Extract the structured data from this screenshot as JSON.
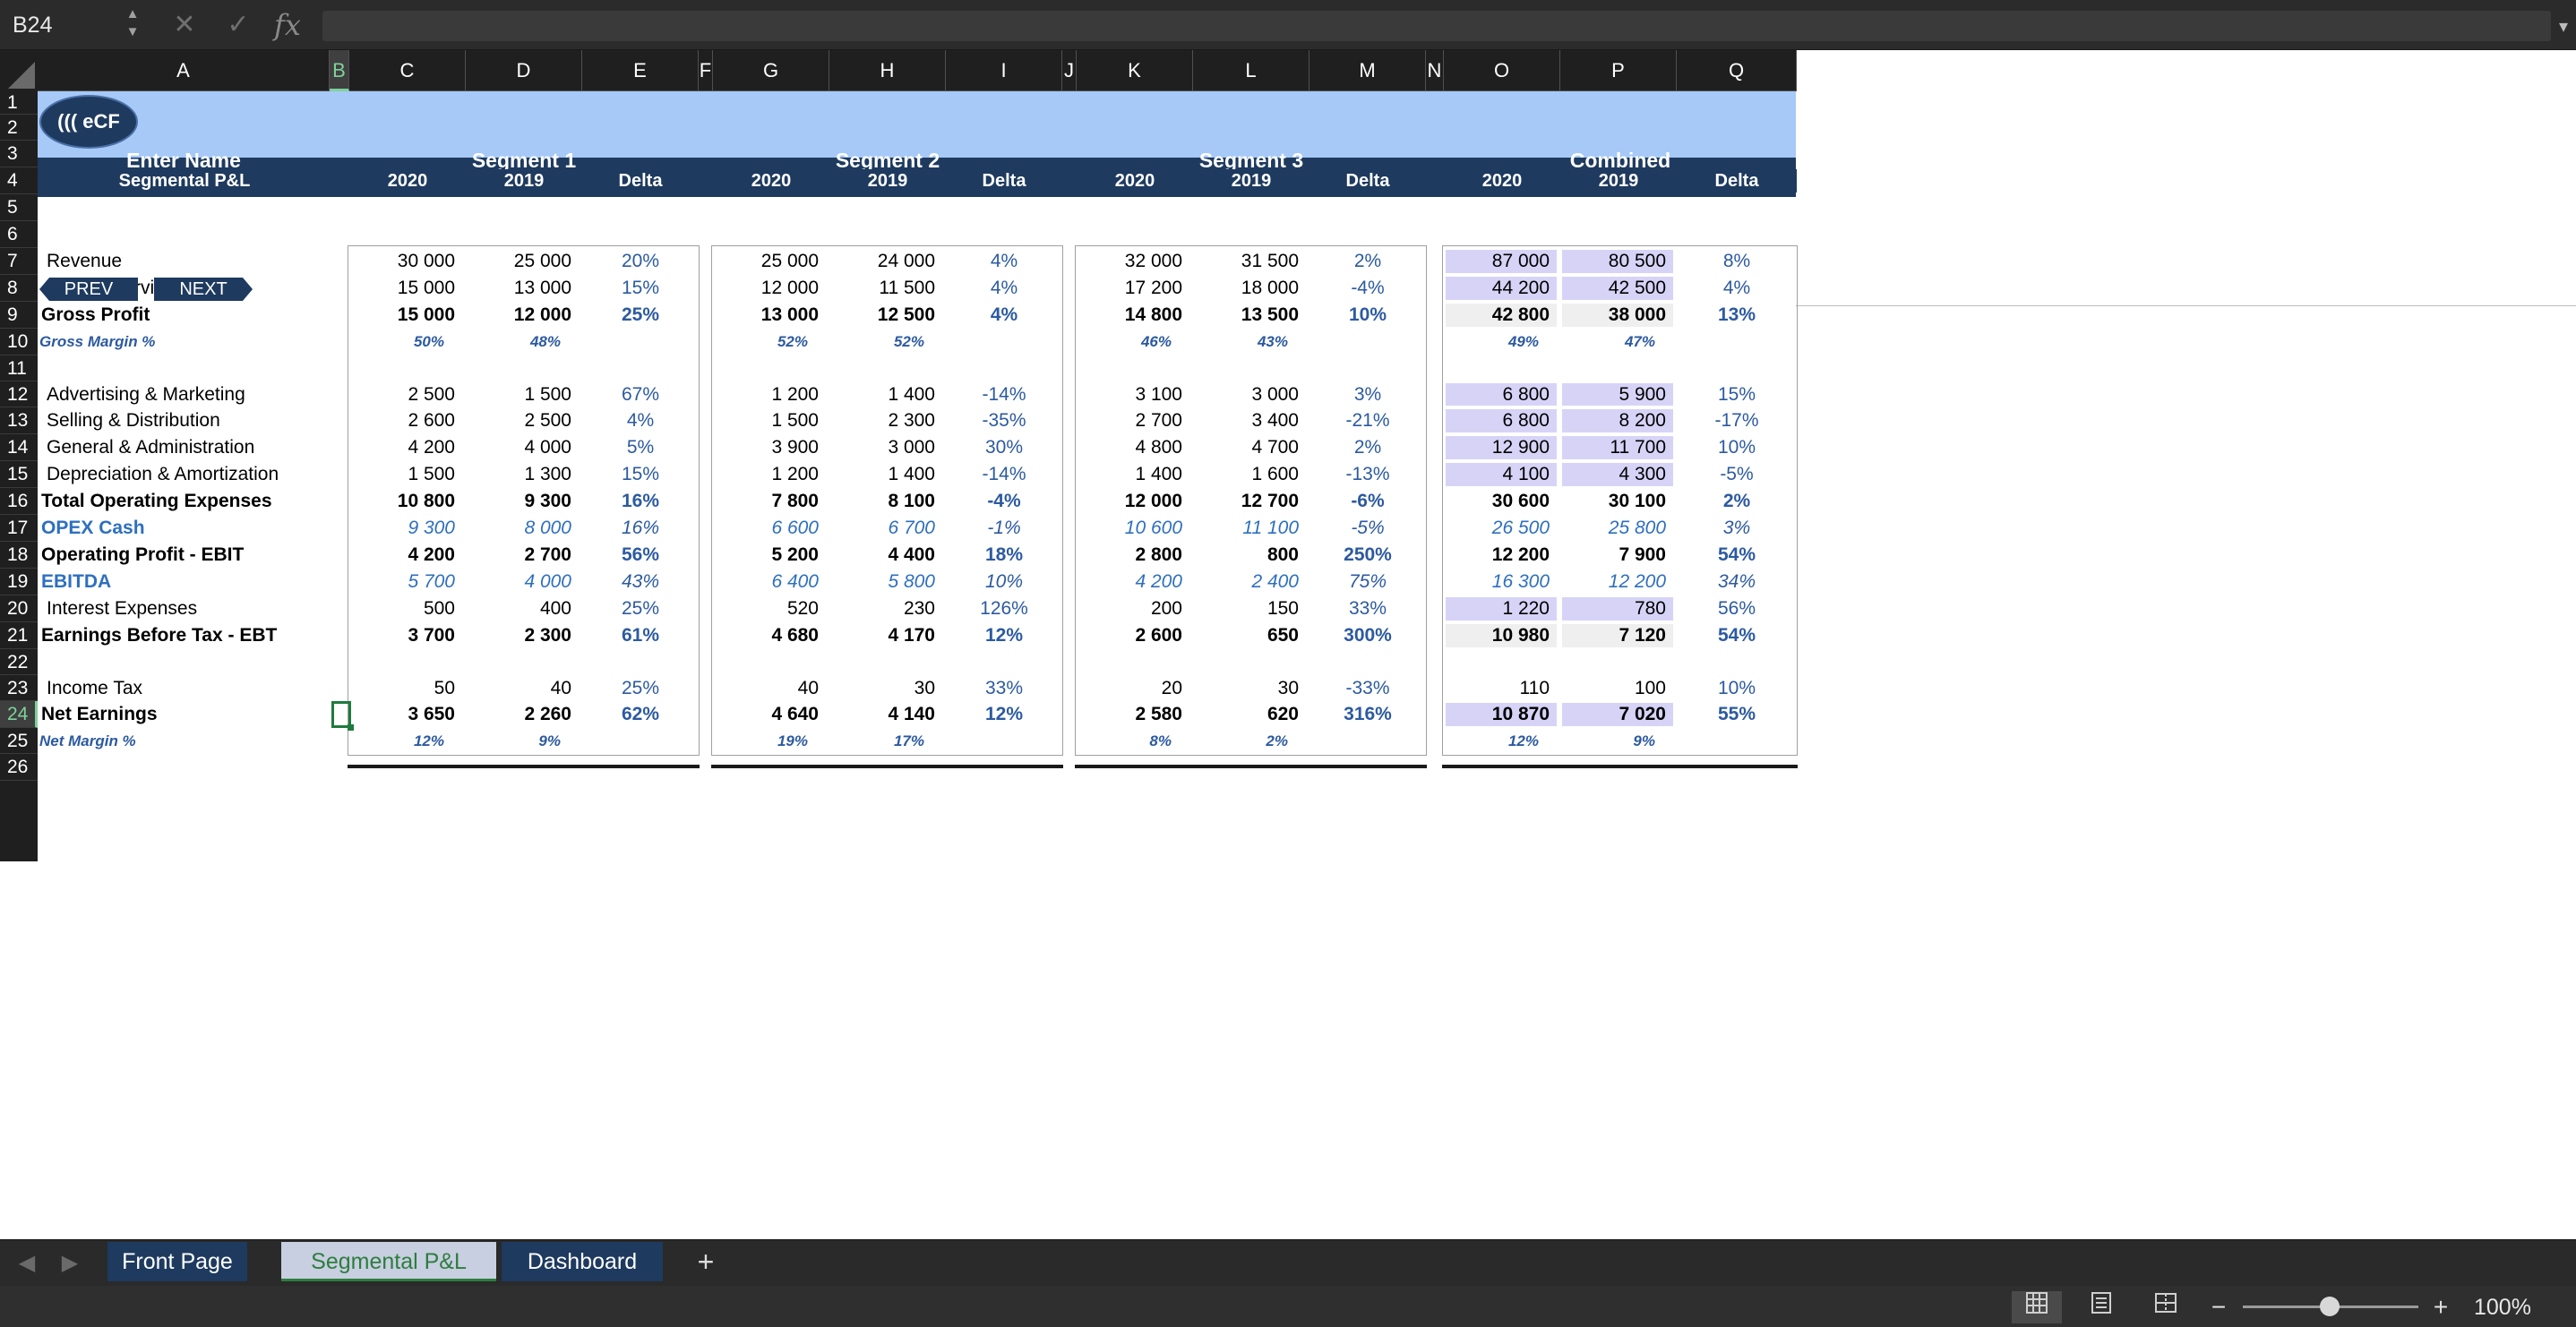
{
  "formula_bar": {
    "name_box": "B24",
    "cancel_glyph": "✕",
    "confirm_glyph": "✓",
    "fx_label": "fx",
    "formula_value": ""
  },
  "columns": [
    "A",
    "B",
    "C",
    "D",
    "E",
    "F",
    "G",
    "H",
    "I",
    "J",
    "K",
    "L",
    "M",
    "N",
    "O",
    "P",
    "Q"
  ],
  "rows": [
    "1",
    "2",
    "3",
    "4",
    "5",
    "6",
    "7",
    "8",
    "9",
    "10",
    "11",
    "12",
    "13",
    "14",
    "15",
    "16",
    "17",
    "18",
    "19",
    "20",
    "21",
    "22",
    "23",
    "24",
    "25",
    "26"
  ],
  "logo_text": "((( eCF",
  "header": {
    "name_label": "Enter Name",
    "sub_label": "Segmental P&L",
    "segments": [
      "Segment 1",
      "Segment 2",
      "Segment 3",
      "Combined"
    ],
    "year_labels": [
      "2020",
      "2019",
      "Delta"
    ]
  },
  "nav": {
    "prev": "PREV",
    "next": "NEXT"
  },
  "lines": [
    {
      "label": "Revenue",
      "style": "normal",
      "s1": [
        "30 000",
        "25 000",
        "20%"
      ],
      "s2": [
        "25 000",
        "24 000",
        "4%"
      ],
      "s3": [
        "32 000",
        "31 500",
        "2%"
      ],
      "c": [
        "87 000",
        "80 500",
        "8%"
      ]
    },
    {
      "label": "Cost of Services",
      "style": "normal",
      "s1": [
        "15 000",
        "13 000",
        "15%"
      ],
      "s2": [
        "12 000",
        "11 500",
        "4%"
      ],
      "s3": [
        "17 200",
        "18 000",
        "-4%"
      ],
      "c": [
        "44 200",
        "42 500",
        "4%"
      ]
    },
    {
      "label": "Gross Profit",
      "style": "bold",
      "s1": [
        "15 000",
        "12 000",
        "25%"
      ],
      "s2": [
        "13 000",
        "12 500",
        "4%"
      ],
      "s3": [
        "14 800",
        "13 500",
        "10%"
      ],
      "c": [
        "42 800",
        "38 000",
        "13%"
      ]
    },
    {
      "label": "Gross Margin %",
      "style": "margin",
      "s1": [
        "50%",
        "48%",
        ""
      ],
      "s2": [
        "52%",
        "52%",
        ""
      ],
      "s3": [
        "46%",
        "43%",
        ""
      ],
      "c": [
        "49%",
        "47%",
        ""
      ]
    },
    {
      "label": "Advertising & Marketing",
      "style": "normal",
      "s1": [
        "2 500",
        "1 500",
        "67%"
      ],
      "s2": [
        "1 200",
        "1 400",
        "-14%"
      ],
      "s3": [
        "3 100",
        "3 000",
        "3%"
      ],
      "c": [
        "6 800",
        "5 900",
        "15%"
      ]
    },
    {
      "label": "Selling & Distribution",
      "style": "normal",
      "s1": [
        "2 600",
        "2 500",
        "4%"
      ],
      "s2": [
        "1 500",
        "2 300",
        "-35%"
      ],
      "s3": [
        "2 700",
        "3 400",
        "-21%"
      ],
      "c": [
        "6 800",
        "8 200",
        "-17%"
      ]
    },
    {
      "label": "General & Administration",
      "style": "normal",
      "s1": [
        "4 200",
        "4 000",
        "5%"
      ],
      "s2": [
        "3 900",
        "3 000",
        "30%"
      ],
      "s3": [
        "4 800",
        "4 700",
        "2%"
      ],
      "c": [
        "12 900",
        "11 700",
        "10%"
      ]
    },
    {
      "label": "Depreciation & Amortization",
      "style": "normal",
      "s1": [
        "1 500",
        "1 300",
        "15%"
      ],
      "s2": [
        "1 200",
        "1 400",
        "-14%"
      ],
      "s3": [
        "1 400",
        "1 600",
        "-13%"
      ],
      "c": [
        "4 100",
        "4 300",
        "-5%"
      ]
    },
    {
      "label": "Total Operating Expenses",
      "style": "bold",
      "s1": [
        "10 800",
        "9 300",
        "16%"
      ],
      "s2": [
        "7 800",
        "8 100",
        "-4%"
      ],
      "s3": [
        "12 000",
        "12 700",
        "-6%"
      ],
      "c": [
        "30 600",
        "30 100",
        "2%"
      ]
    },
    {
      "label": "OPEX Cash",
      "style": "blue",
      "s1": [
        "9 300",
        "8 000",
        "16%"
      ],
      "s2": [
        "6 600",
        "6 700",
        "-1%"
      ],
      "s3": [
        "10 600",
        "11 100",
        "-5%"
      ],
      "c": [
        "26 500",
        "25 800",
        "3%"
      ]
    },
    {
      "label": "Operating Profit - EBIT",
      "style": "bold",
      "s1": [
        "4 200",
        "2 700",
        "56%"
      ],
      "s2": [
        "5 200",
        "4 400",
        "18%"
      ],
      "s3": [
        "2 800",
        "800",
        "250%"
      ],
      "c": [
        "12 200",
        "7 900",
        "54%"
      ]
    },
    {
      "label": "EBITDA",
      "style": "blue",
      "s1": [
        "5 700",
        "4 000",
        "43%"
      ],
      "s2": [
        "6 400",
        "5 800",
        "10%"
      ],
      "s3": [
        "4 200",
        "2 400",
        "75%"
      ],
      "c": [
        "16 300",
        "12 200",
        "34%"
      ]
    },
    {
      "label": "Interest Expenses",
      "style": "normal",
      "s1": [
        "500",
        "400",
        "25%"
      ],
      "s2": [
        "520",
        "230",
        "126%"
      ],
      "s3": [
        "200",
        "150",
        "33%"
      ],
      "c": [
        "1 220",
        "780",
        "56%"
      ]
    },
    {
      "label": "Earnings Before Tax - EBT",
      "style": "bold",
      "s1": [
        "3 700",
        "2 300",
        "61%"
      ],
      "s2": [
        "4 680",
        "4 170",
        "12%"
      ],
      "s3": [
        "2 600",
        "650",
        "300%"
      ],
      "c": [
        "10 980",
        "7 120",
        "54%"
      ]
    },
    {
      "label": "Income Tax",
      "style": "normal",
      "s1": [
        "50",
        "40",
        "25%"
      ],
      "s2": [
        "40",
        "30",
        "33%"
      ],
      "s3": [
        "20",
        "30",
        "-33%"
      ],
      "c": [
        "110",
        "100",
        "10%"
      ]
    },
    {
      "label": "Net Earnings",
      "style": "bold",
      "s1": [
        "3 650",
        "2 260",
        "62%"
      ],
      "s2": [
        "4 640",
        "4 140",
        "12%"
      ],
      "s3": [
        "2 580",
        "620",
        "316%"
      ],
      "c": [
        "10 870",
        "7 020",
        "55%"
      ]
    },
    {
      "label": "Net Margin %",
      "style": "margin",
      "s1": [
        "12%",
        "9%",
        ""
      ],
      "s2": [
        "19%",
        "17%",
        ""
      ],
      "s3": [
        "8%",
        "2%",
        ""
      ],
      "c": [
        "12%",
        "9%",
        ""
      ]
    }
  ],
  "sheet_tabs": [
    {
      "label": "Front Page",
      "active": false
    },
    {
      "label": "Segmental P&L",
      "active": true
    },
    {
      "label": "Dashboard",
      "active": false
    }
  ],
  "add_sheet": "+",
  "status": {
    "zoom": "100%",
    "zoom_minus": "−",
    "zoom_plus": "+"
  },
  "colors": {
    "header_navy": "#1e3a5f",
    "band_light_blue": "#a6c9f7",
    "highlight_lavender": "#d7d3f7",
    "selection_green": "#1f7a3f"
  }
}
